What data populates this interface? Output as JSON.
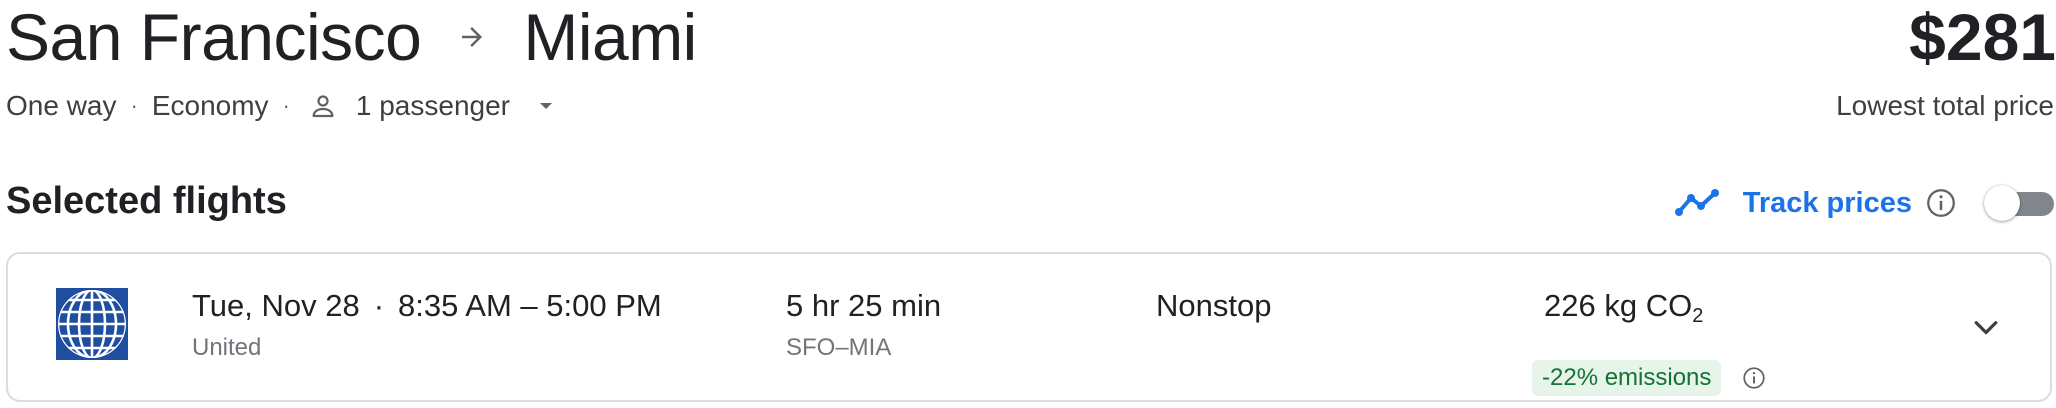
{
  "header": {
    "origin": "San Francisco",
    "destination": "Miami",
    "price": "$281",
    "price_caption": "Lowest total price"
  },
  "trip": {
    "type": "One way",
    "cabin": "Economy",
    "passengers": "1 passenger",
    "separator": "·"
  },
  "selected": {
    "title": "Selected flights",
    "track_label": "Track prices",
    "track_enabled": false
  },
  "flight": {
    "date": "Tue, Nov 28",
    "separator": "·",
    "times": "8:35 AM – 5:00 PM",
    "airline": "United",
    "duration": "5 hr 25 min",
    "route": "SFO–MIA",
    "stops": "Nonstop",
    "emissions_value": "226 kg CO",
    "emissions_subscript": "2",
    "emissions_delta": "-22% emissions"
  },
  "icons": {
    "route_arrow": "arrow-right-icon",
    "passenger": "person-icon",
    "dropdown": "caret-down-icon",
    "trend": "trend-line-icon",
    "info": "info-icon",
    "expand": "chevron-down-icon",
    "airline_logo": "united-globe-logo"
  },
  "colors": {
    "accent": "#1a73e8",
    "text": "#202124",
    "muted": "#70757a",
    "emissions_bg": "#e6f4ea",
    "emissions_fg": "#137333",
    "airline_blue": "#1f4ea1"
  }
}
